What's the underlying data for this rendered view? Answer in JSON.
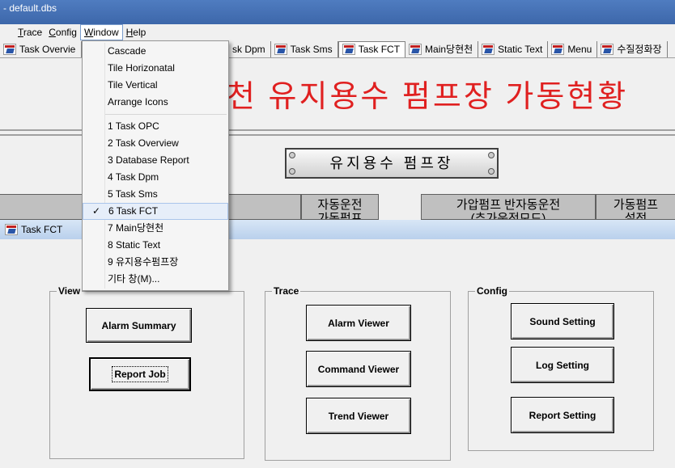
{
  "window": {
    "title": "- default.dbs"
  },
  "menubar": [
    {
      "id": "trace",
      "label": "Trace",
      "underline": "T",
      "rest": "race"
    },
    {
      "id": "config",
      "label": "Config",
      "underline": "C",
      "rest": "onfig"
    },
    {
      "id": "window",
      "label": "Window",
      "underline": "W",
      "rest": "indow",
      "active": true
    },
    {
      "id": "help",
      "label": "Help",
      "underline": "H",
      "rest": "elp"
    }
  ],
  "tabs": [
    {
      "label": "Task Overvie"
    },
    {
      "label": ""
    },
    {
      "label": "sk Dpm"
    },
    {
      "label": "Task Sms"
    },
    {
      "label": "Task FCT",
      "selected": true
    },
    {
      "label": "Main당현천"
    },
    {
      "label": "Static Text"
    },
    {
      "label": "Menu"
    },
    {
      "label": "수질정화장"
    }
  ],
  "banner": {
    "title": "천 유지용수 펌프장 가동현황"
  },
  "station": {
    "label": "유지용수 펌프장"
  },
  "headers": [
    {
      "label": "자동운전\n가동펌프"
    },
    {
      "label": "가압펌프 반자동운전\n(추가운전모드)"
    },
    {
      "label": "가동펌프\n설정"
    }
  ],
  "child_window": {
    "title": "Task FCT"
  },
  "groups": {
    "view": {
      "title": "View",
      "buttons": [
        {
          "label": "Alarm Summary"
        },
        {
          "label": "Report Job"
        }
      ]
    },
    "trace": {
      "title": "Trace",
      "buttons": [
        {
          "label": "Alarm Viewer"
        },
        {
          "label": "Command Viewer"
        },
        {
          "label": "Trend Viewer"
        }
      ]
    },
    "config": {
      "title": "Config",
      "buttons": [
        {
          "label": "Sound Setting"
        },
        {
          "label": "Log Setting"
        },
        {
          "label": "Report Setting"
        }
      ]
    }
  },
  "window_menu": {
    "group1": [
      "Cascade",
      "Tile Horizonatal",
      "Tile Vertical",
      "Arrange Icons"
    ],
    "group2": [
      {
        "label": "1 Task OPC"
      },
      {
        "label": "2 Task Overview"
      },
      {
        "label": "3 Database Report"
      },
      {
        "label": "4 Task Dpm"
      },
      {
        "label": "5 Task Sms"
      },
      {
        "label": "6 Task FCT",
        "checked": true,
        "check_mark": "✓"
      },
      {
        "label": "7 Main당현천"
      },
      {
        "label": "8 Static Text"
      },
      {
        "label": "9 유지용수펌프장"
      },
      {
        "label": "기타 창(M)..."
      }
    ]
  },
  "colors": {
    "title_bar": "#4f7cc0",
    "banner_text": "#e02020",
    "child_title_bar": "#c8dcf2",
    "menu_highlight": "#e6eef9"
  }
}
